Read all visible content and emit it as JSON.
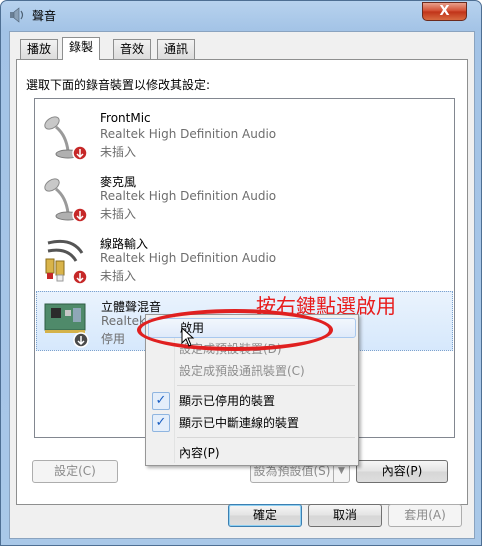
{
  "window": {
    "title": "聲音",
    "close_label": "X"
  },
  "tabs": [
    {
      "label": "播放"
    },
    {
      "label": "錄製"
    },
    {
      "label": "音效"
    },
    {
      "label": "通訊"
    }
  ],
  "instruction": "選取下面的錄音裝置以修改其設定:",
  "devices": [
    {
      "name": "FrontMic",
      "driver": "Realtek High Definition Audio",
      "status": "未插入"
    },
    {
      "name": "麥克風",
      "driver": "Realtek High Definition Audio",
      "status": "未插入"
    },
    {
      "name": "線路輸入",
      "driver": "Realtek High Definition Audio",
      "status": "未插入"
    },
    {
      "name": "立體聲混音",
      "driver": "Realtek",
      "status": "停用"
    }
  ],
  "annotation": "按右鍵點選啟用",
  "context_menu": {
    "items": [
      {
        "label": "啟用"
      },
      {
        "label": "設定成預設裝置(D)"
      },
      {
        "label": "設定成預設通訊裝置(C)"
      },
      {
        "label": "顯示已停用的裝置"
      },
      {
        "label": "顯示已中斷連線的裝置"
      },
      {
        "label": "內容(P)"
      }
    ]
  },
  "buttons": {
    "configure": "設定(C)",
    "set_default": "設為預設值(S)",
    "properties": "內容(P)",
    "ok": "確定",
    "cancel": "取消",
    "apply": "套用(A)"
  },
  "colors": {
    "annotation": "#e81c1c",
    "selection": "#d6e8fc",
    "title_bar": "#a9c8e8"
  }
}
